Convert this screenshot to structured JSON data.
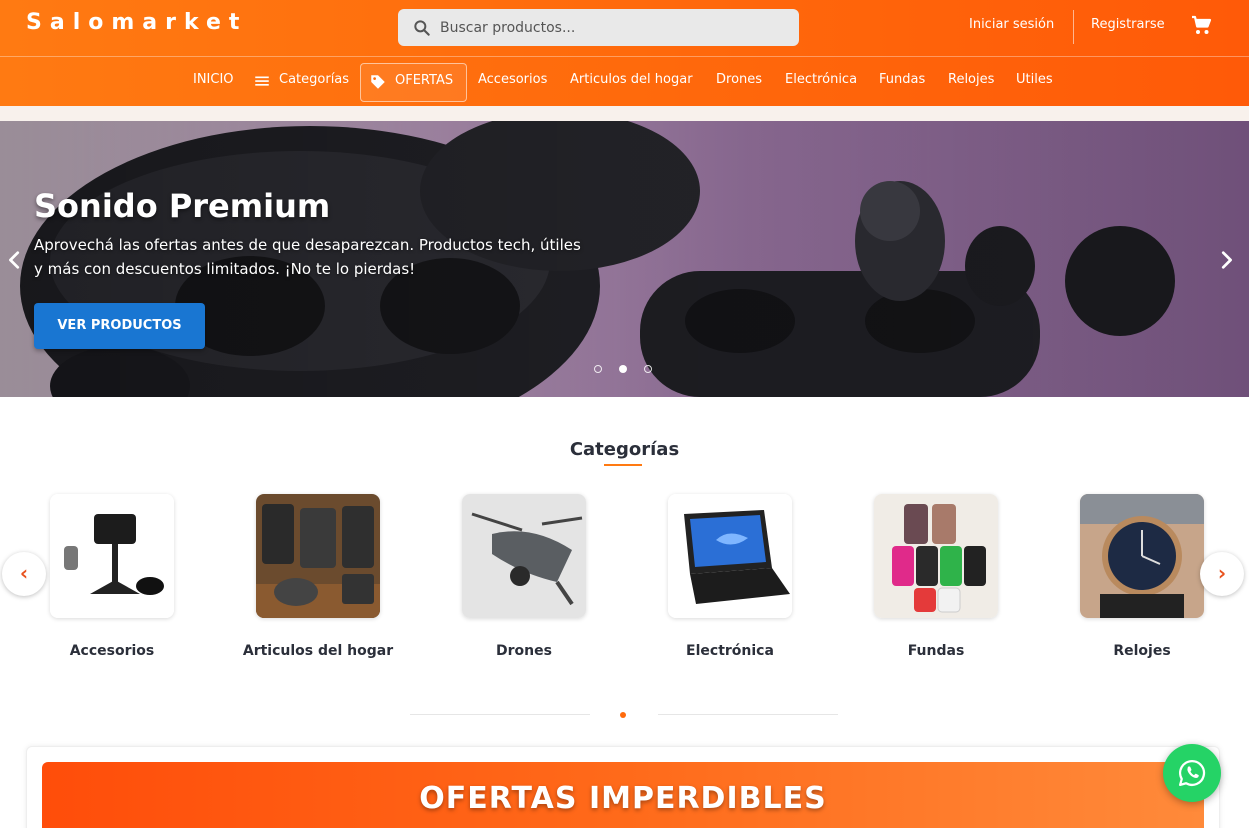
{
  "header": {
    "logo": "Salomarket",
    "search_placeholder": "Buscar productos...",
    "login_label": "Iniciar sesión",
    "register_label": "Registrarse",
    "cart_icon": "cart-icon"
  },
  "nav": {
    "items": [
      {
        "label": "INICIO"
      },
      {
        "label": "Categorías",
        "icon": "menu-icon"
      },
      {
        "label": "OFERTAS",
        "icon": "tag-icon"
      },
      {
        "label": "Accesorios"
      },
      {
        "label": "Articulos del hogar"
      },
      {
        "label": "Drones"
      },
      {
        "label": "Electrónica"
      },
      {
        "label": "Fundas"
      },
      {
        "label": "Relojes"
      },
      {
        "label": "Utiles"
      }
    ]
  },
  "hero": {
    "title": "Sonido Premium",
    "description": "Aprovechá las ofertas antes de que desaparezcan. Productos tech, útiles y más con descuentos limitados. ¡No te lo pierdas!",
    "button_label": "VER PRODUCTOS",
    "slide_count": 3,
    "active_slide": 2
  },
  "categories": {
    "title": "Categorías",
    "items": [
      {
        "label": "Accesorios"
      },
      {
        "label": "Articulos del hogar"
      },
      {
        "label": "Drones"
      },
      {
        "label": "Electrónica"
      },
      {
        "label": "Fundas"
      },
      {
        "label": "Relojes"
      }
    ],
    "prev_glyph": "‹",
    "next_glyph": "›"
  },
  "offers": {
    "title": "OFERTAS IMPERDIBLES"
  },
  "colors": {
    "brand_orange": "#ff6a0c",
    "button_blue": "#1976d2",
    "whatsapp_green": "#25d366"
  }
}
